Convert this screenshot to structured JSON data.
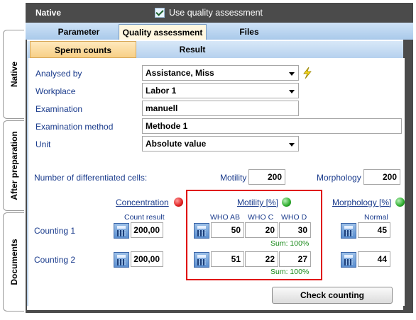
{
  "vertical_tabs": [
    "Native",
    "After preparation",
    "Documents"
  ],
  "header": {
    "title": "Native",
    "use_quality_label": "Use quality assessment"
  },
  "main_tabs": [
    "Parameter",
    "Quality assessment",
    "Files"
  ],
  "sub_tabs": [
    "Sperm counts",
    "Result"
  ],
  "form": {
    "analysed_by": {
      "label": "Analysed by",
      "value": "Assistance, Miss"
    },
    "workplace": {
      "label": "Workplace",
      "value": "Labor 1"
    },
    "examination": {
      "label": "Examination",
      "value": "manuell"
    },
    "examination_method": {
      "label": "Examination method",
      "value": "Methode 1"
    },
    "unit": {
      "label": "Unit",
      "value": "Absolute value"
    }
  },
  "differentiated": {
    "label": "Number of differentiated cells:",
    "motility_label": "Motility",
    "motility_value": "200",
    "morphology_label": "Morphology",
    "morphology_value": "200"
  },
  "sections": {
    "concentration": "Concentration",
    "motility": "Motility [%]",
    "morphology": "Morphology [%]",
    "count_result": "Count result",
    "who_ab": "WHO AB",
    "who_c": "WHO C",
    "who_d": "WHO  D",
    "normal": "Normal"
  },
  "status_colors": {
    "concentration": "#e02020",
    "motility": "#2fae2f",
    "morphology": "#2fae2f"
  },
  "rows": [
    {
      "label": "Counting 1",
      "concentration": "200,00",
      "who_ab": "50",
      "who_c": "20",
      "who_d": "30",
      "sum": "Sum: 100%",
      "normal": "45"
    },
    {
      "label": "Counting 2",
      "concentration": "200,00",
      "who_ab": "51",
      "who_c": "22",
      "who_d": "27",
      "sum": "Sum: 100%",
      "normal": "44"
    }
  ],
  "check_button": "Check counting"
}
